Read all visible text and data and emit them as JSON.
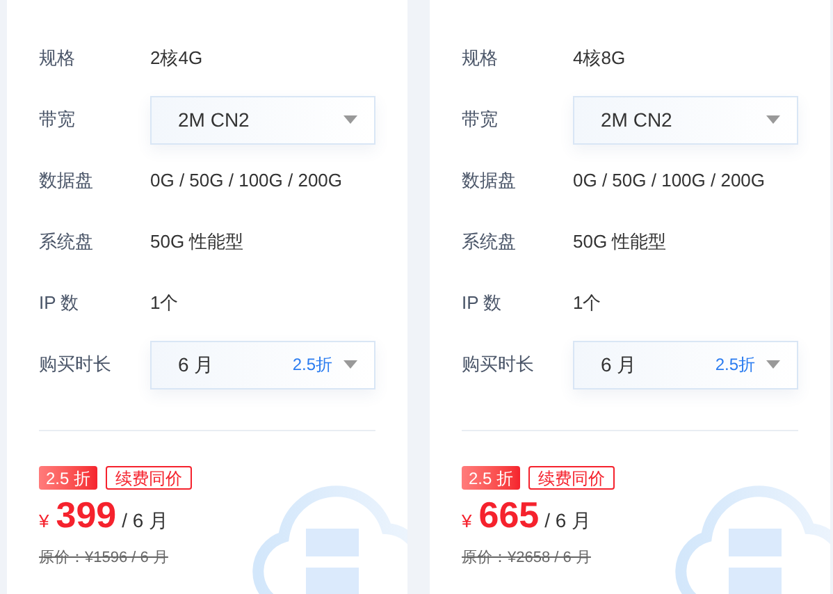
{
  "plans": [
    {
      "rows": [
        {
          "kind": "text",
          "label": "规格",
          "value": "2核4G"
        },
        {
          "kind": "select",
          "label": "带宽",
          "value": "2M CN2"
        },
        {
          "kind": "text",
          "label": "数据盘",
          "value": "0G / 50G / 100G / 200G"
        },
        {
          "kind": "text",
          "label": "系统盘",
          "value": "50G 性能型"
        },
        {
          "kind": "text",
          "label": "IP 数",
          "value": "1个"
        },
        {
          "kind": "select",
          "label": "购买时长",
          "value": "6 月",
          "tag": "2.5折"
        }
      ],
      "discount": "2.5 折",
      "renewal": "续费同价",
      "currency": "¥",
      "price": "399",
      "period": "/ 6 月",
      "original": "原价：¥1596 / 6 月"
    },
    {
      "rows": [
        {
          "kind": "text",
          "label": "规格",
          "value": "4核8G"
        },
        {
          "kind": "select",
          "label": "带宽",
          "value": "2M CN2"
        },
        {
          "kind": "text",
          "label": "数据盘",
          "value": "0G / 50G / 100G / 200G"
        },
        {
          "kind": "text",
          "label": "系统盘",
          "value": "50G 性能型"
        },
        {
          "kind": "text",
          "label": "IP 数",
          "value": "1个"
        },
        {
          "kind": "select",
          "label": "购买时长",
          "value": "6 月",
          "tag": "2.5折"
        }
      ],
      "discount": "2.5 折",
      "renewal": "续费同价",
      "currency": "¥",
      "price": "665",
      "period": "/ 6 月",
      "original": "原价：¥2658 / 6 月"
    }
  ]
}
